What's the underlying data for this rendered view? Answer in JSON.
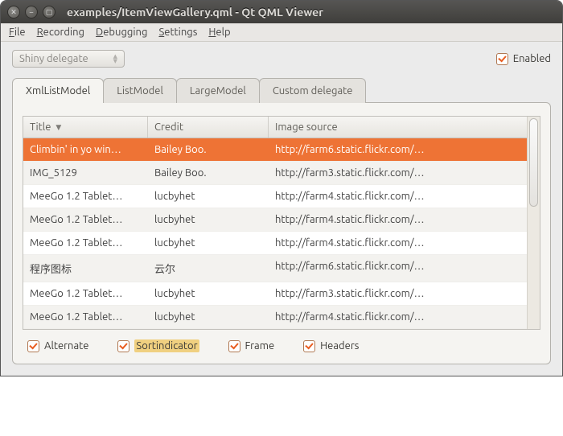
{
  "window": {
    "title": "examples/ItemViewGallery.qml - Qt QML Viewer"
  },
  "menu": {
    "file": "File",
    "recording": "Recording",
    "debugging": "Debugging",
    "settings": "Settings",
    "help": "Help"
  },
  "top": {
    "combo_value": "Shiny delegate",
    "enabled_label": "Enabled"
  },
  "tabs": {
    "xml": "XmlListModel",
    "list": "ListModel",
    "large": "LargeModel",
    "custom": "Custom delegate"
  },
  "headers": {
    "title": "Title",
    "credit": "Credit",
    "src": "Image source"
  },
  "rows": [
    {
      "title": "Climbin' in yo  win…",
      "credit": "Bailey Boo.",
      "src": "http://farm6.static.flickr.com/…"
    },
    {
      "title": "IMG_5129",
      "credit": "Bailey Boo.",
      "src": "http://farm3.static.flickr.com/…"
    },
    {
      "title": "MeeGo 1.2 Tablet…",
      "credit": "lucbyhet",
      "src": "http://farm4.static.flickr.com/…"
    },
    {
      "title": "MeeGo 1.2 Tablet…",
      "credit": "lucbyhet",
      "src": "http://farm4.static.flickr.com/…"
    },
    {
      "title": "MeeGo 1.2 Tablet…",
      "credit": "lucbyhet",
      "src": "http://farm4.static.flickr.com/…"
    },
    {
      "title": "程序图标",
      "credit": "云尔",
      "src": "http://farm6.static.flickr.com/…"
    },
    {
      "title": "MeeGo 1.2 Tablet…",
      "credit": "lucbyhet",
      "src": "http://farm3.static.flickr.com/…"
    },
    {
      "title": "MeeGo 1.2 Tablet…",
      "credit": "lucbyhet",
      "src": "http://farm4.static.flickr.com/…"
    }
  ],
  "opts": {
    "alternate": "Alternate",
    "sortindicator": "Sortindicator",
    "frame": "Frame",
    "headers": "Headers"
  }
}
